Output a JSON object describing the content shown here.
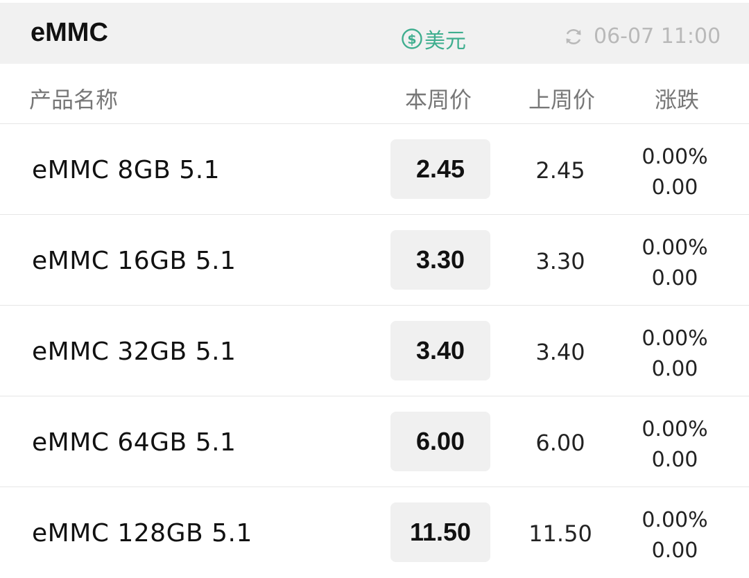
{
  "header": {
    "title": "eMMC",
    "currency_label": "美元",
    "updated_time": "06-07 11:00"
  },
  "columns": {
    "name": "产品名称",
    "this_week": "本周价",
    "last_week": "上周价",
    "change": "涨跌"
  },
  "rows": [
    {
      "name": "eMMC 8GB 5.1",
      "this_week": "2.45",
      "last_week": "2.45",
      "change_pct": "0.00%",
      "change_abs": "0.00"
    },
    {
      "name": "eMMC 16GB 5.1",
      "this_week": "3.30",
      "last_week": "3.30",
      "change_pct": "0.00%",
      "change_abs": "0.00"
    },
    {
      "name": "eMMC 32GB 5.1",
      "this_week": "3.40",
      "last_week": "3.40",
      "change_pct": "0.00%",
      "change_abs": "0.00"
    },
    {
      "name": "eMMC 64GB 5.1",
      "this_week": "6.00",
      "last_week": "6.00",
      "change_pct": "0.00%",
      "change_abs": "0.00"
    },
    {
      "name": "eMMC 128GB 5.1",
      "this_week": "11.50",
      "last_week": "11.50",
      "change_pct": "0.00%",
      "change_abs": "0.00"
    }
  ],
  "icons": {
    "currency": "dollar-circle-icon",
    "refresh": "refresh-icon"
  },
  "colors": {
    "accent": "#3fae8f",
    "muted": "#b9b9b9",
    "header_bg": "#f1f1f1",
    "price_chip_bg": "#f0f0f0"
  }
}
